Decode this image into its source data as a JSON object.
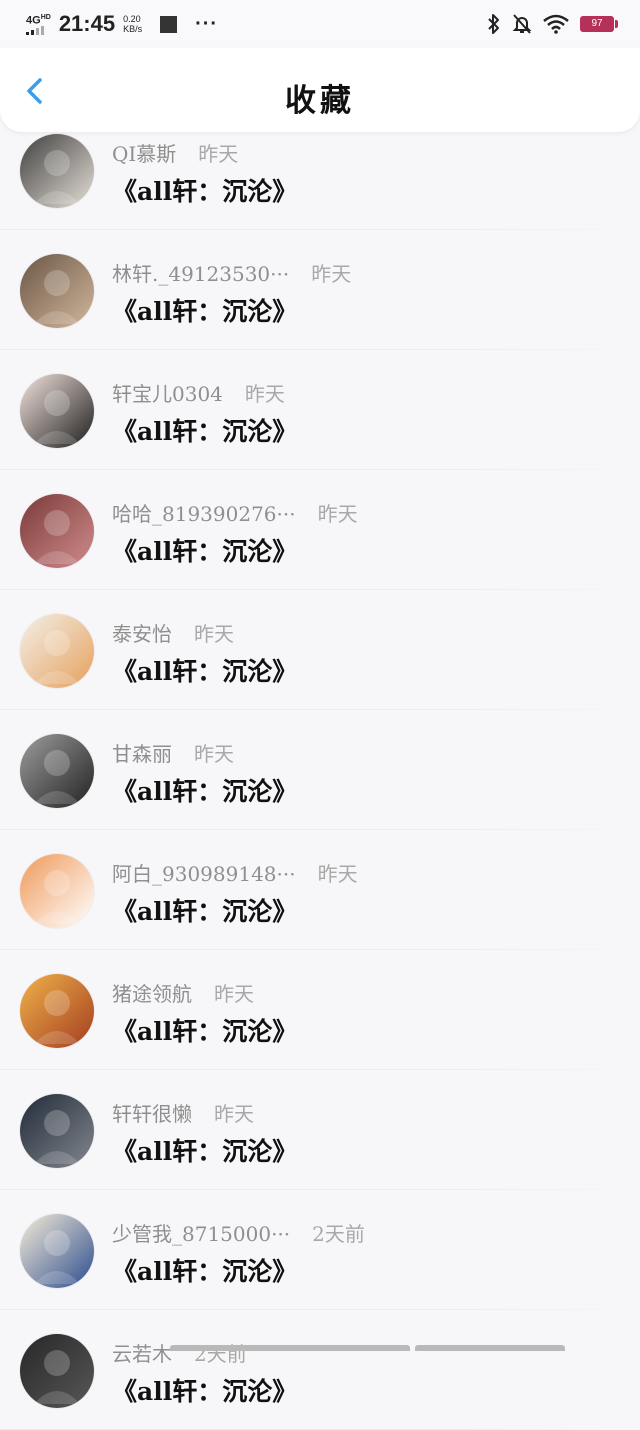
{
  "status": {
    "network": "4G",
    "network_hd": "HD",
    "time": "21:45",
    "speed_value": "0.20",
    "speed_unit": "KB/s",
    "dots": "···",
    "battery": "97"
  },
  "header": {
    "title": "收藏"
  },
  "items": [
    {
      "username": "QI慕斯",
      "time": "昨天",
      "title": "《all轩：沉沦》",
      "avatar_colors": [
        "#404040",
        "#e6dfd7"
      ]
    },
    {
      "username": "林轩._49123530···",
      "time": "昨天",
      "title": "《all轩：沉沦》",
      "avatar_colors": [
        "#6b5646",
        "#d1b79c"
      ]
    },
    {
      "username": "轩宝儿0304",
      "time": "昨天",
      "title": "《all轩：沉沦》",
      "avatar_colors": [
        "#f4e4de",
        "#1d1d1d"
      ]
    },
    {
      "username": "哈哈_819390276···",
      "time": "昨天",
      "title": "《all轩：沉沦》",
      "avatar_colors": [
        "#7b3b3a",
        "#cf8b8b"
      ]
    },
    {
      "username": "泰安怡",
      "time": "昨天",
      "title": "《all轩：沉沦》",
      "avatar_colors": [
        "#f3f0e8",
        "#e6a05d"
      ]
    },
    {
      "username": "甘森丽",
      "time": "昨天",
      "title": "《all轩：沉沦》",
      "avatar_colors": [
        "#9d9d9d",
        "#222222"
      ]
    },
    {
      "username": "阿白_930989148···",
      "time": "昨天",
      "title": "《all轩：沉沦》",
      "avatar_colors": [
        "#ef9a5b",
        "#ffffff"
      ]
    },
    {
      "username": "猪途领航",
      "time": "昨天",
      "title": "《all轩：沉沦》",
      "avatar_colors": [
        "#f0b24a",
        "#a33d20"
      ]
    },
    {
      "username": "轩轩很懒",
      "time": "昨天",
      "title": "《all轩：沉沦》",
      "avatar_colors": [
        "#202b38",
        "#83878e"
      ]
    },
    {
      "username": "少管我_8715000···",
      "time": "2天前",
      "title": "《all轩：沉沦》",
      "avatar_colors": [
        "#f7edd8",
        "#2c4d8e"
      ]
    },
    {
      "username": "云若木",
      "time": "2天前",
      "title": "《all轩：沉沦》",
      "avatar_colors": [
        "#272727",
        "#575757"
      ]
    }
  ]
}
